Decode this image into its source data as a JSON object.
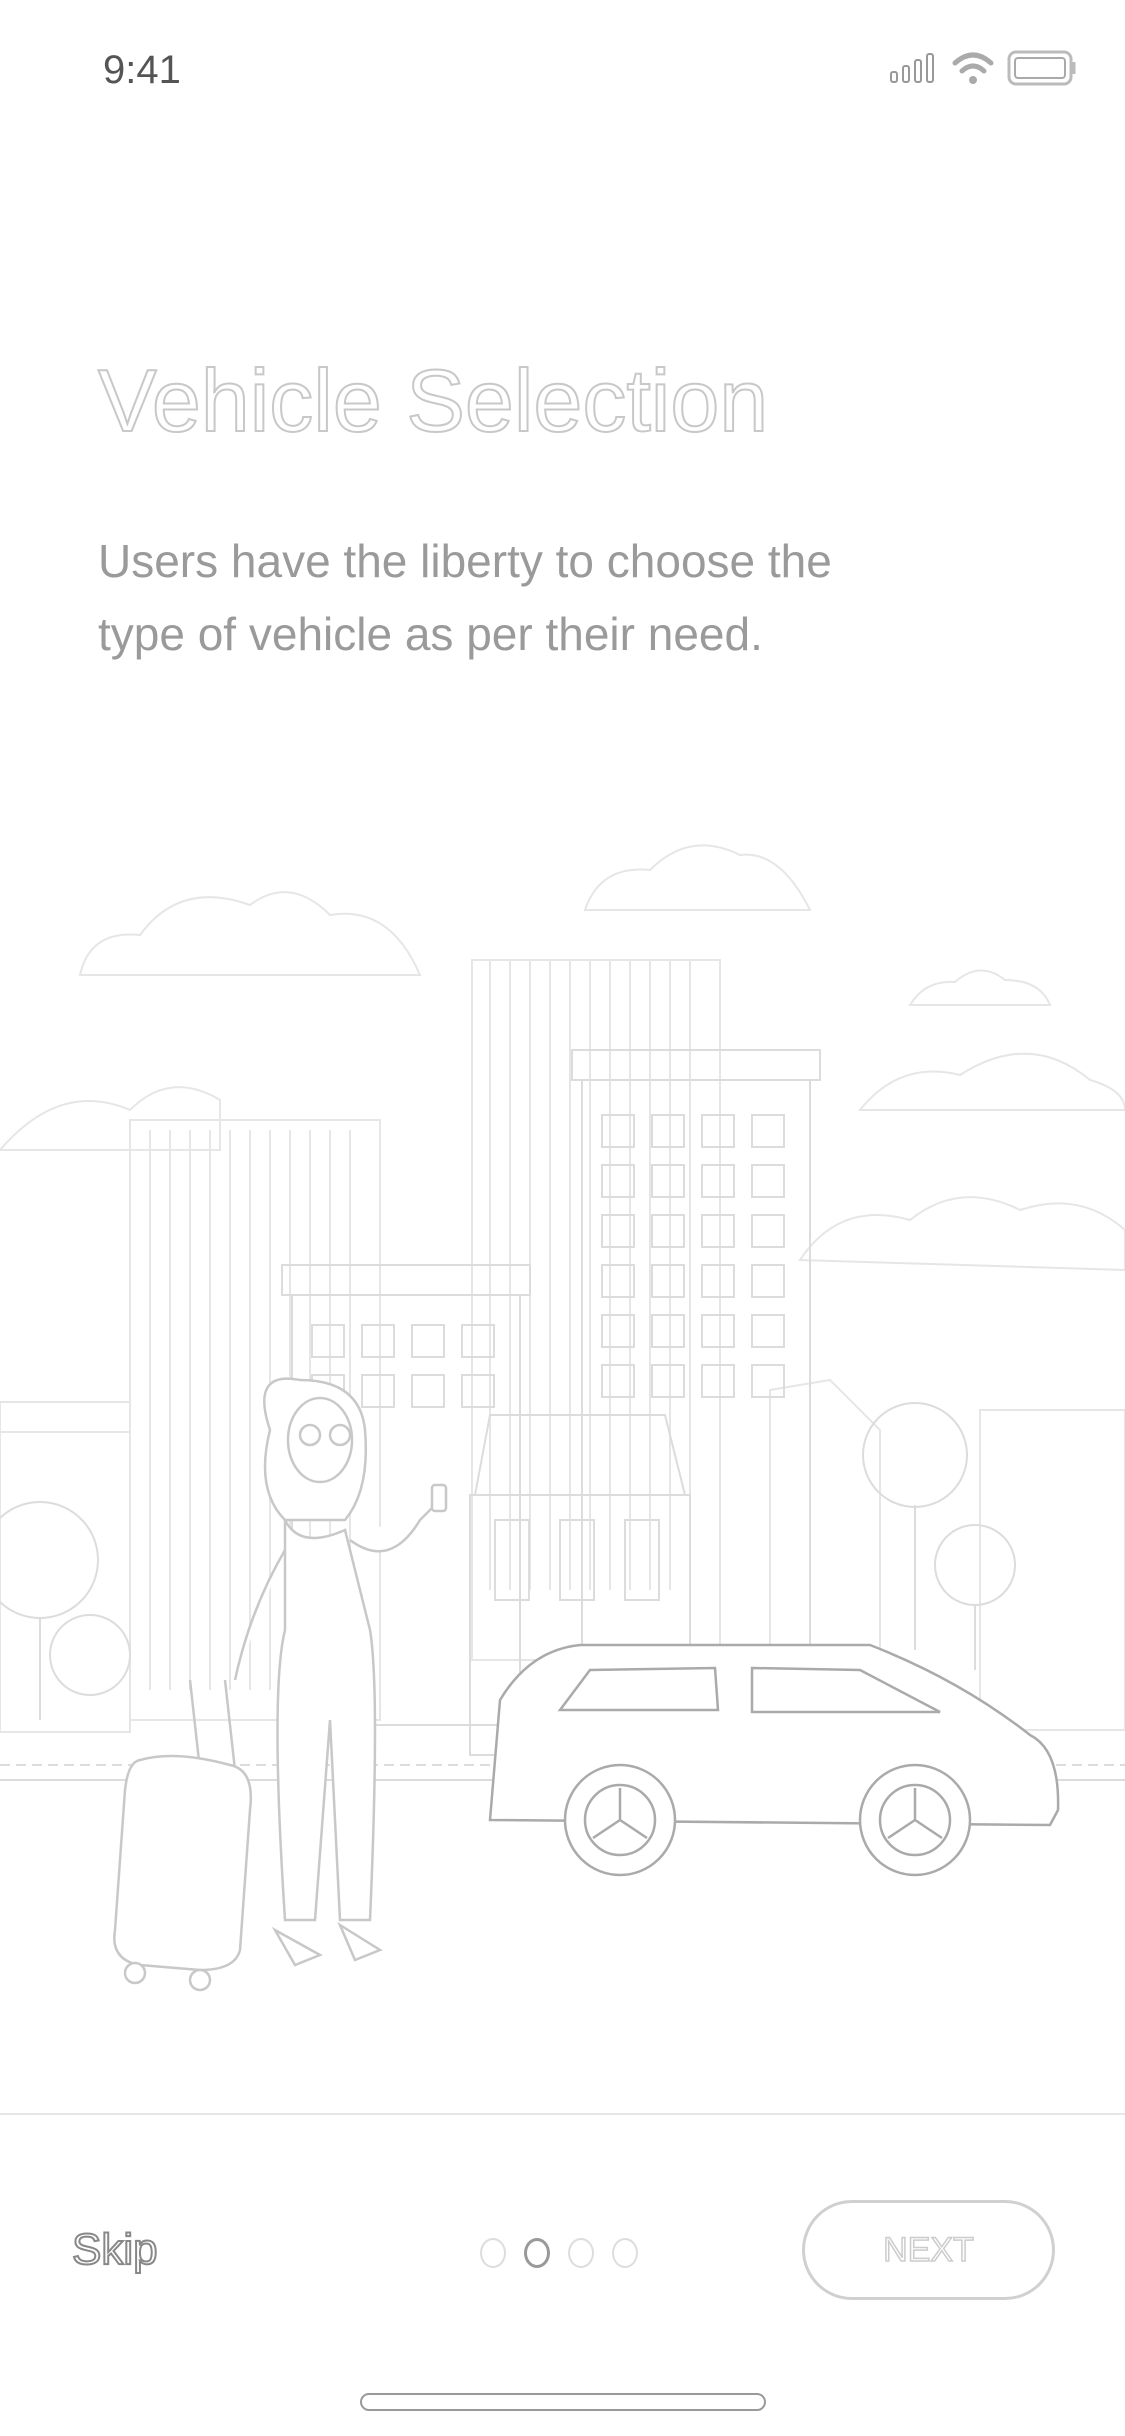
{
  "status_bar": {
    "time": "9:41",
    "icons": [
      "cellular-signal-icon",
      "wifi-icon",
      "battery-icon"
    ]
  },
  "onboarding": {
    "title": "Vehicle Selection",
    "description": "Users have the liberty to choose the type of vehicle as per their need.",
    "illustration": "city-street-woman-luggage-car",
    "page_count": 4,
    "current_page": 2
  },
  "footer": {
    "skip_label": "Skip",
    "next_label": "NEXT"
  }
}
